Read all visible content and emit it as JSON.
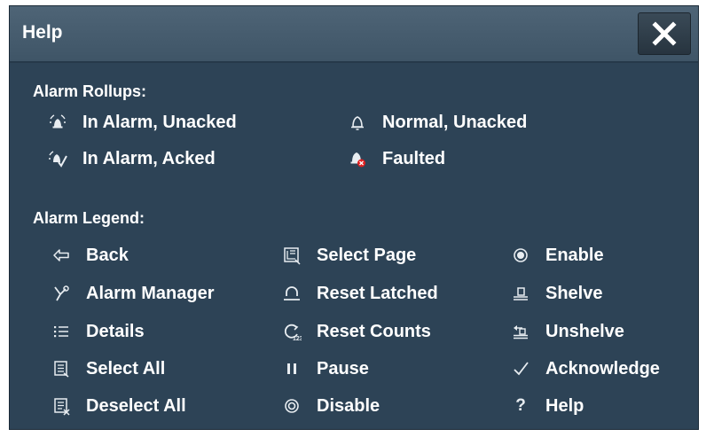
{
  "dialog": {
    "title": "Help",
    "close_icon": "close-x-icon"
  },
  "rollups": {
    "heading": "Alarm Rollups:",
    "items": [
      {
        "label": "In Alarm, Unacked",
        "icon": "alarm-bell-ringing-icon"
      },
      {
        "label": "Normal, Unacked",
        "icon": "bell-outline-icon"
      },
      {
        "label": "In Alarm, Acked",
        "icon": "alarm-bell-acked-icon"
      },
      {
        "label": "Faulted",
        "icon": "bell-faulted-icon",
        "badge_color": "#e02020"
      }
    ]
  },
  "legend": {
    "heading": "Alarm Legend:",
    "col1": [
      {
        "label": "Back",
        "icon": "back-arrow-icon"
      },
      {
        "label": "Alarm Manager",
        "icon": "alarm-manager-icon"
      },
      {
        "label": "Details",
        "icon": "details-list-icon"
      },
      {
        "label": "Select All",
        "icon": "select-all-icon"
      },
      {
        "label": "Deselect All",
        "icon": "deselect-all-icon"
      }
    ],
    "col2": [
      {
        "label": "Select Page",
        "icon": "select-page-icon"
      },
      {
        "label": "Reset Latched",
        "icon": "reset-latched-icon"
      },
      {
        "label": "Reset Counts",
        "icon": "reset-counts-icon",
        "icon_text": "123"
      },
      {
        "label": "Pause",
        "icon": "pause-icon"
      },
      {
        "label": "Disable",
        "icon": "disable-icon"
      }
    ],
    "col3": [
      {
        "label": "Enable",
        "icon": "enable-icon"
      },
      {
        "label": "Shelve",
        "icon": "shelve-icon"
      },
      {
        "label": "Unshelve",
        "icon": "unshelve-icon"
      },
      {
        "label": "Acknowledge",
        "icon": "checkmark-icon"
      },
      {
        "label": "Help",
        "icon": "help-icon",
        "icon_text": "?"
      }
    ]
  },
  "colors": {
    "panel": "#2d4356",
    "titlebar": "#45596b",
    "text": "#ffffff",
    "fault_badge": "#e02020"
  }
}
